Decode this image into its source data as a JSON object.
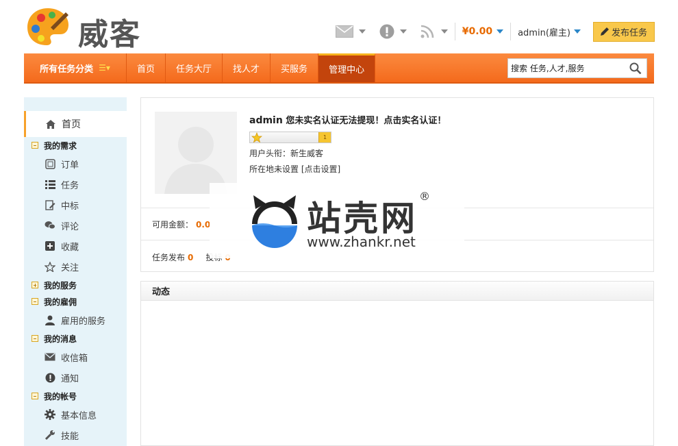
{
  "brand": {
    "name": "威客"
  },
  "header": {
    "balance": "¥0.00",
    "user": "admin(雇主)",
    "publish_label": "发布任务"
  },
  "nav": {
    "category_label": "所有任务分类",
    "items": [
      {
        "label": "首页"
      },
      {
        "label": "任务大厅"
      },
      {
        "label": "找人才"
      },
      {
        "label": "买服务"
      },
      {
        "label": "管理中心"
      }
    ],
    "search_placeholder": "搜索 任务,人才,服务"
  },
  "sidebar": {
    "home": "首页",
    "groups": [
      {
        "label": "我的需求",
        "expanded": true,
        "items": [
          {
            "label": "订单",
            "icon": "order-icon"
          },
          {
            "label": "任务",
            "icon": "list-icon"
          },
          {
            "label": "中标",
            "icon": "edit-icon"
          },
          {
            "label": "评论",
            "icon": "comment-icon"
          },
          {
            "label": "收藏",
            "icon": "plus-square-icon"
          },
          {
            "label": "关注",
            "icon": "star-icon"
          }
        ]
      },
      {
        "label": "我的服务",
        "expanded": false,
        "items": []
      },
      {
        "label": "我的雇佣",
        "expanded": true,
        "items": [
          {
            "label": "雇用的服务",
            "icon": "user-icon"
          }
        ]
      },
      {
        "label": "我的消息",
        "expanded": true,
        "items": [
          {
            "label": "收信箱",
            "icon": "mail-icon"
          },
          {
            "label": "通知",
            "icon": "alert-icon"
          }
        ]
      },
      {
        "label": "我的帐号",
        "expanded": true,
        "items": [
          {
            "label": "基本信息",
            "icon": "gear-icon"
          },
          {
            "label": "技能",
            "icon": "wrench-icon"
          }
        ]
      }
    ]
  },
  "profile": {
    "username": "admin",
    "warning": "您未实名认证无法提现！点击实名认证！",
    "level_badge": "1",
    "title_line": "用户头衔：新生威客",
    "location_text": "所在地未设置",
    "location_link": "[点击设置]"
  },
  "stats": {
    "available_label": "可用金额：",
    "available_value": "0.0",
    "task_publish_label": "任务发布",
    "task_publish_value": "0",
    "bid_label": "投标",
    "bid_value": "0"
  },
  "activity": {
    "title": "动态"
  },
  "watermark": {
    "title": "站壳网",
    "url": "www.zhankr.net",
    "reg": "®"
  }
}
